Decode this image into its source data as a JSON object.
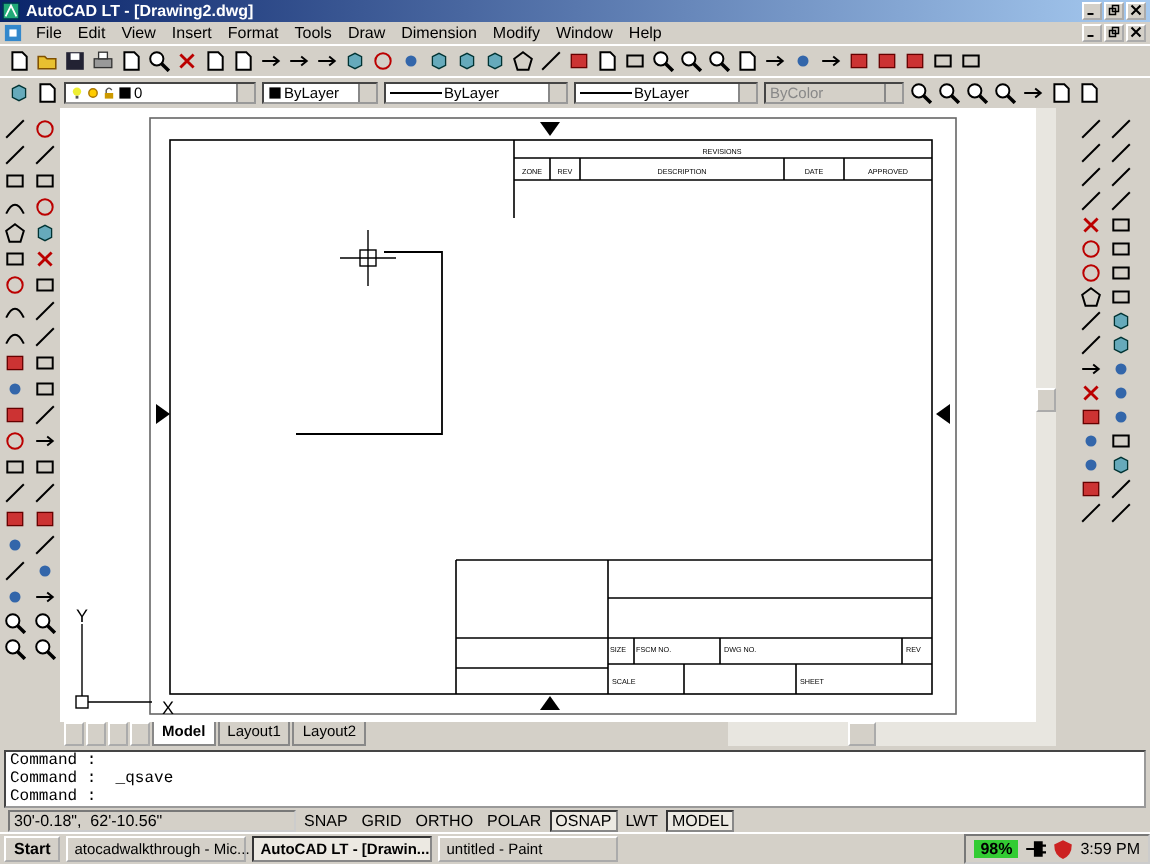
{
  "window": {
    "title": "AutoCAD LT - [Drawing2.dwg]"
  },
  "menu": [
    "File",
    "Edit",
    "View",
    "Insert",
    "Format",
    "Tools",
    "Draw",
    "Dimension",
    "Modify",
    "Window",
    "Help"
  ],
  "properties_bar": {
    "layer": "0",
    "color_control": "ByLayer",
    "linetype": "ByLayer",
    "lineweight": "ByLayer",
    "plot_style": {
      "value": "ByColor",
      "disabled": true
    }
  },
  "drawing": {
    "revision_block": {
      "title": "REVISIONS",
      "columns": [
        "ZONE",
        "REV",
        "DESCRIPTION",
        "DATE",
        "APPROVED"
      ]
    },
    "title_block": {
      "labels": [
        "SIZE",
        "FSCM NO.",
        "DWG NO.",
        "REV",
        "SCALE",
        "SHEET"
      ]
    },
    "ucs_axes": [
      "Y",
      "X"
    ]
  },
  "layout_tabs": [
    {
      "label": "Model",
      "selected": true
    },
    {
      "label": "Layout1",
      "selected": false
    },
    {
      "label": "Layout2",
      "selected": false
    }
  ],
  "command_lines": [
    "Command :",
    "Command :  _qsave",
    "Command :"
  ],
  "status_bar": {
    "coordinates": "30'-0.18\",  62'-10.56\"",
    "toggles": [
      {
        "label": "SNAP",
        "on": false
      },
      {
        "label": "GRID",
        "on": false
      },
      {
        "label": "ORTHO",
        "on": false
      },
      {
        "label": "POLAR",
        "on": false
      },
      {
        "label": "OSNAP",
        "on": true
      },
      {
        "label": "LWT",
        "on": false
      },
      {
        "label": "MODEL",
        "on": true
      }
    ]
  },
  "taskbar": {
    "start": "Start",
    "tasks": [
      {
        "label": "atocadwalkthrough - Mic...",
        "selected": false
      },
      {
        "label": "AutoCAD LT - [Drawin...",
        "selected": true
      },
      {
        "label": "untitled - Paint",
        "selected": false
      }
    ],
    "battery": "98%",
    "clock": "3:59 PM"
  }
}
